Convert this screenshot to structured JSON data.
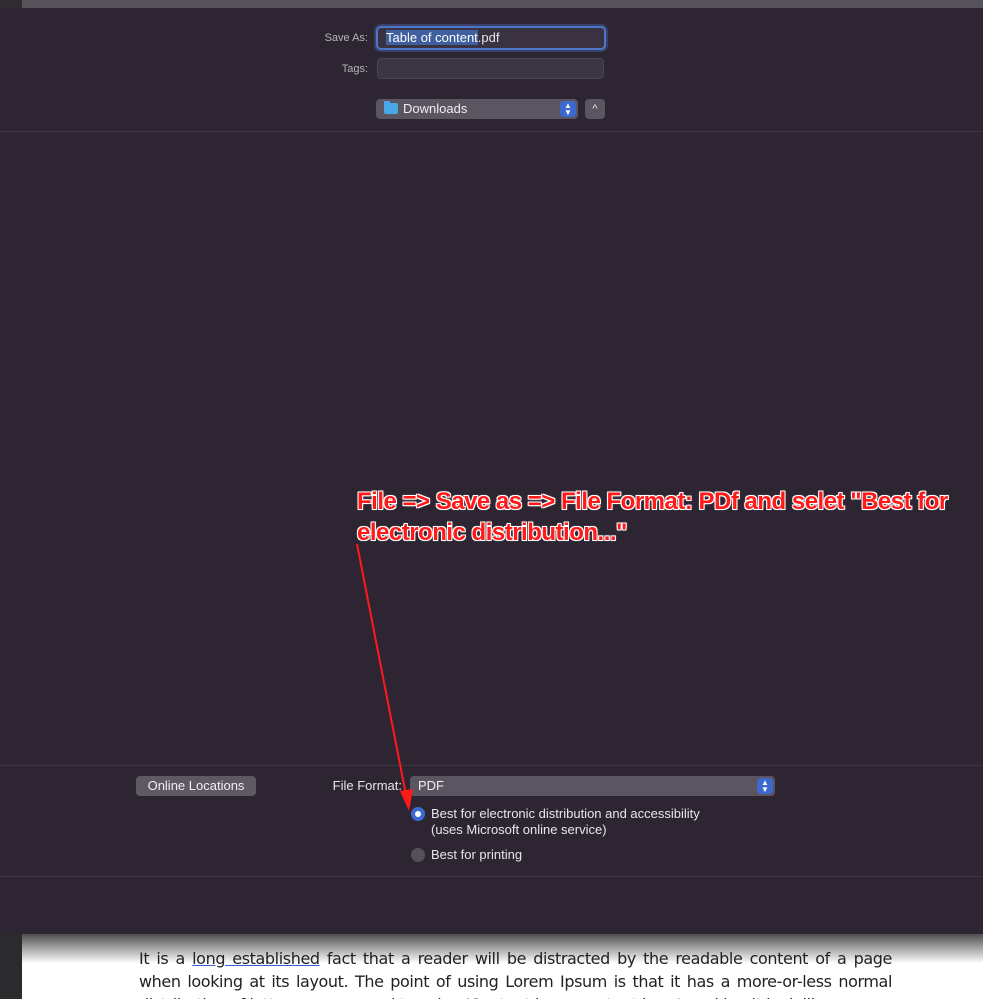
{
  "dialog": {
    "save_as_label": "Save As:",
    "file_name_selected": "Table of content",
    "file_name_ext": ".pdf",
    "tags_label": "Tags:",
    "tags_value": "",
    "location": "Downloads",
    "expand_icon": "chevron-up-icon",
    "folder_icon": "folder-icon"
  },
  "bottom": {
    "online_locations_label": "Online Locations",
    "file_format_label": "File Format:",
    "file_format_value": "PDF",
    "options": [
      {
        "label_line1": "Best for electronic distribution and accessibility",
        "label_line2": "(uses Microsoft online service)",
        "selected": true
      },
      {
        "label_line1": "Best for printing",
        "label_line2": "",
        "selected": false
      }
    ]
  },
  "annotation": {
    "text": "File => Save as => File Format: PDf and selet \"Best for electronic distribution...\"",
    "color": "#ff1a1a"
  },
  "document": {
    "text_before_link": "It is a ",
    "link_text": "long established",
    "text_after_link": " fact that a reader will be distracted by the readable content of a page when looking at its layout. The point of using Lorem Ipsum is that it has a more-or-less normal distribution of letters, as opposed to using 'Content here, content here', making it look like"
  },
  "colors": {
    "accent": "#3c69cf",
    "dialog_bg": "#2e2533"
  }
}
